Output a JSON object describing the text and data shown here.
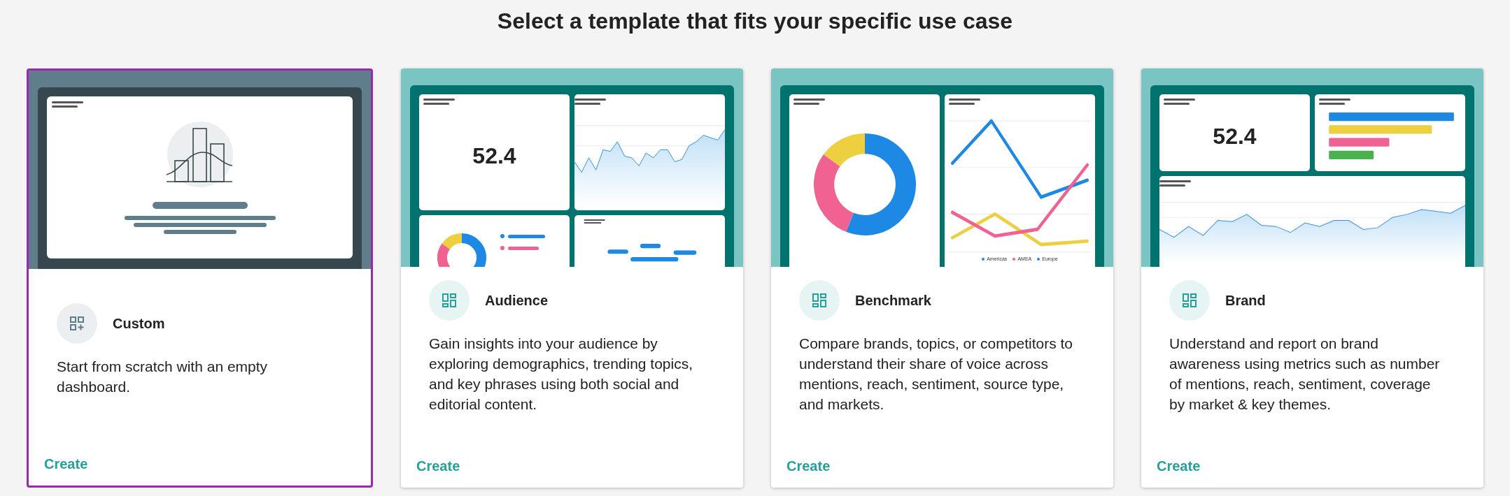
{
  "heading": "Select a template that fits your specific use case",
  "cards": [
    {
      "kind": "custom",
      "selected": true,
      "title": "Custom",
      "description": "Start from scratch with an empty dashboard.",
      "action": "Create"
    },
    {
      "kind": "audience",
      "selected": false,
      "title": "Audience",
      "description": "Gain insights into your audience by exploring demographics, trending topics, and key phrases using both social and editorial content.",
      "action": "Create",
      "preview": {
        "metric": "52.4"
      }
    },
    {
      "kind": "benchmark",
      "selected": false,
      "title": "Benchmark",
      "description": "Compare brands, topics, or competitors to understand their share of voice across mentions, reach, sentiment, source type, and markets.",
      "action": "Create",
      "preview": {
        "legend": [
          {
            "label": "Americas",
            "color": "#1e88e5"
          },
          {
            "label": "AMEA",
            "color": "#f06292"
          },
          {
            "label": "Europe",
            "color": "#1e88e5"
          }
        ]
      }
    },
    {
      "kind": "brand",
      "selected": false,
      "title": "Brand",
      "description": "Understand and report on brand awareness using metrics such as number of mentions, reach, sentiment, coverage by market & key themes.",
      "action": "Create",
      "preview": {
        "metric": "52.4"
      }
    }
  ]
}
